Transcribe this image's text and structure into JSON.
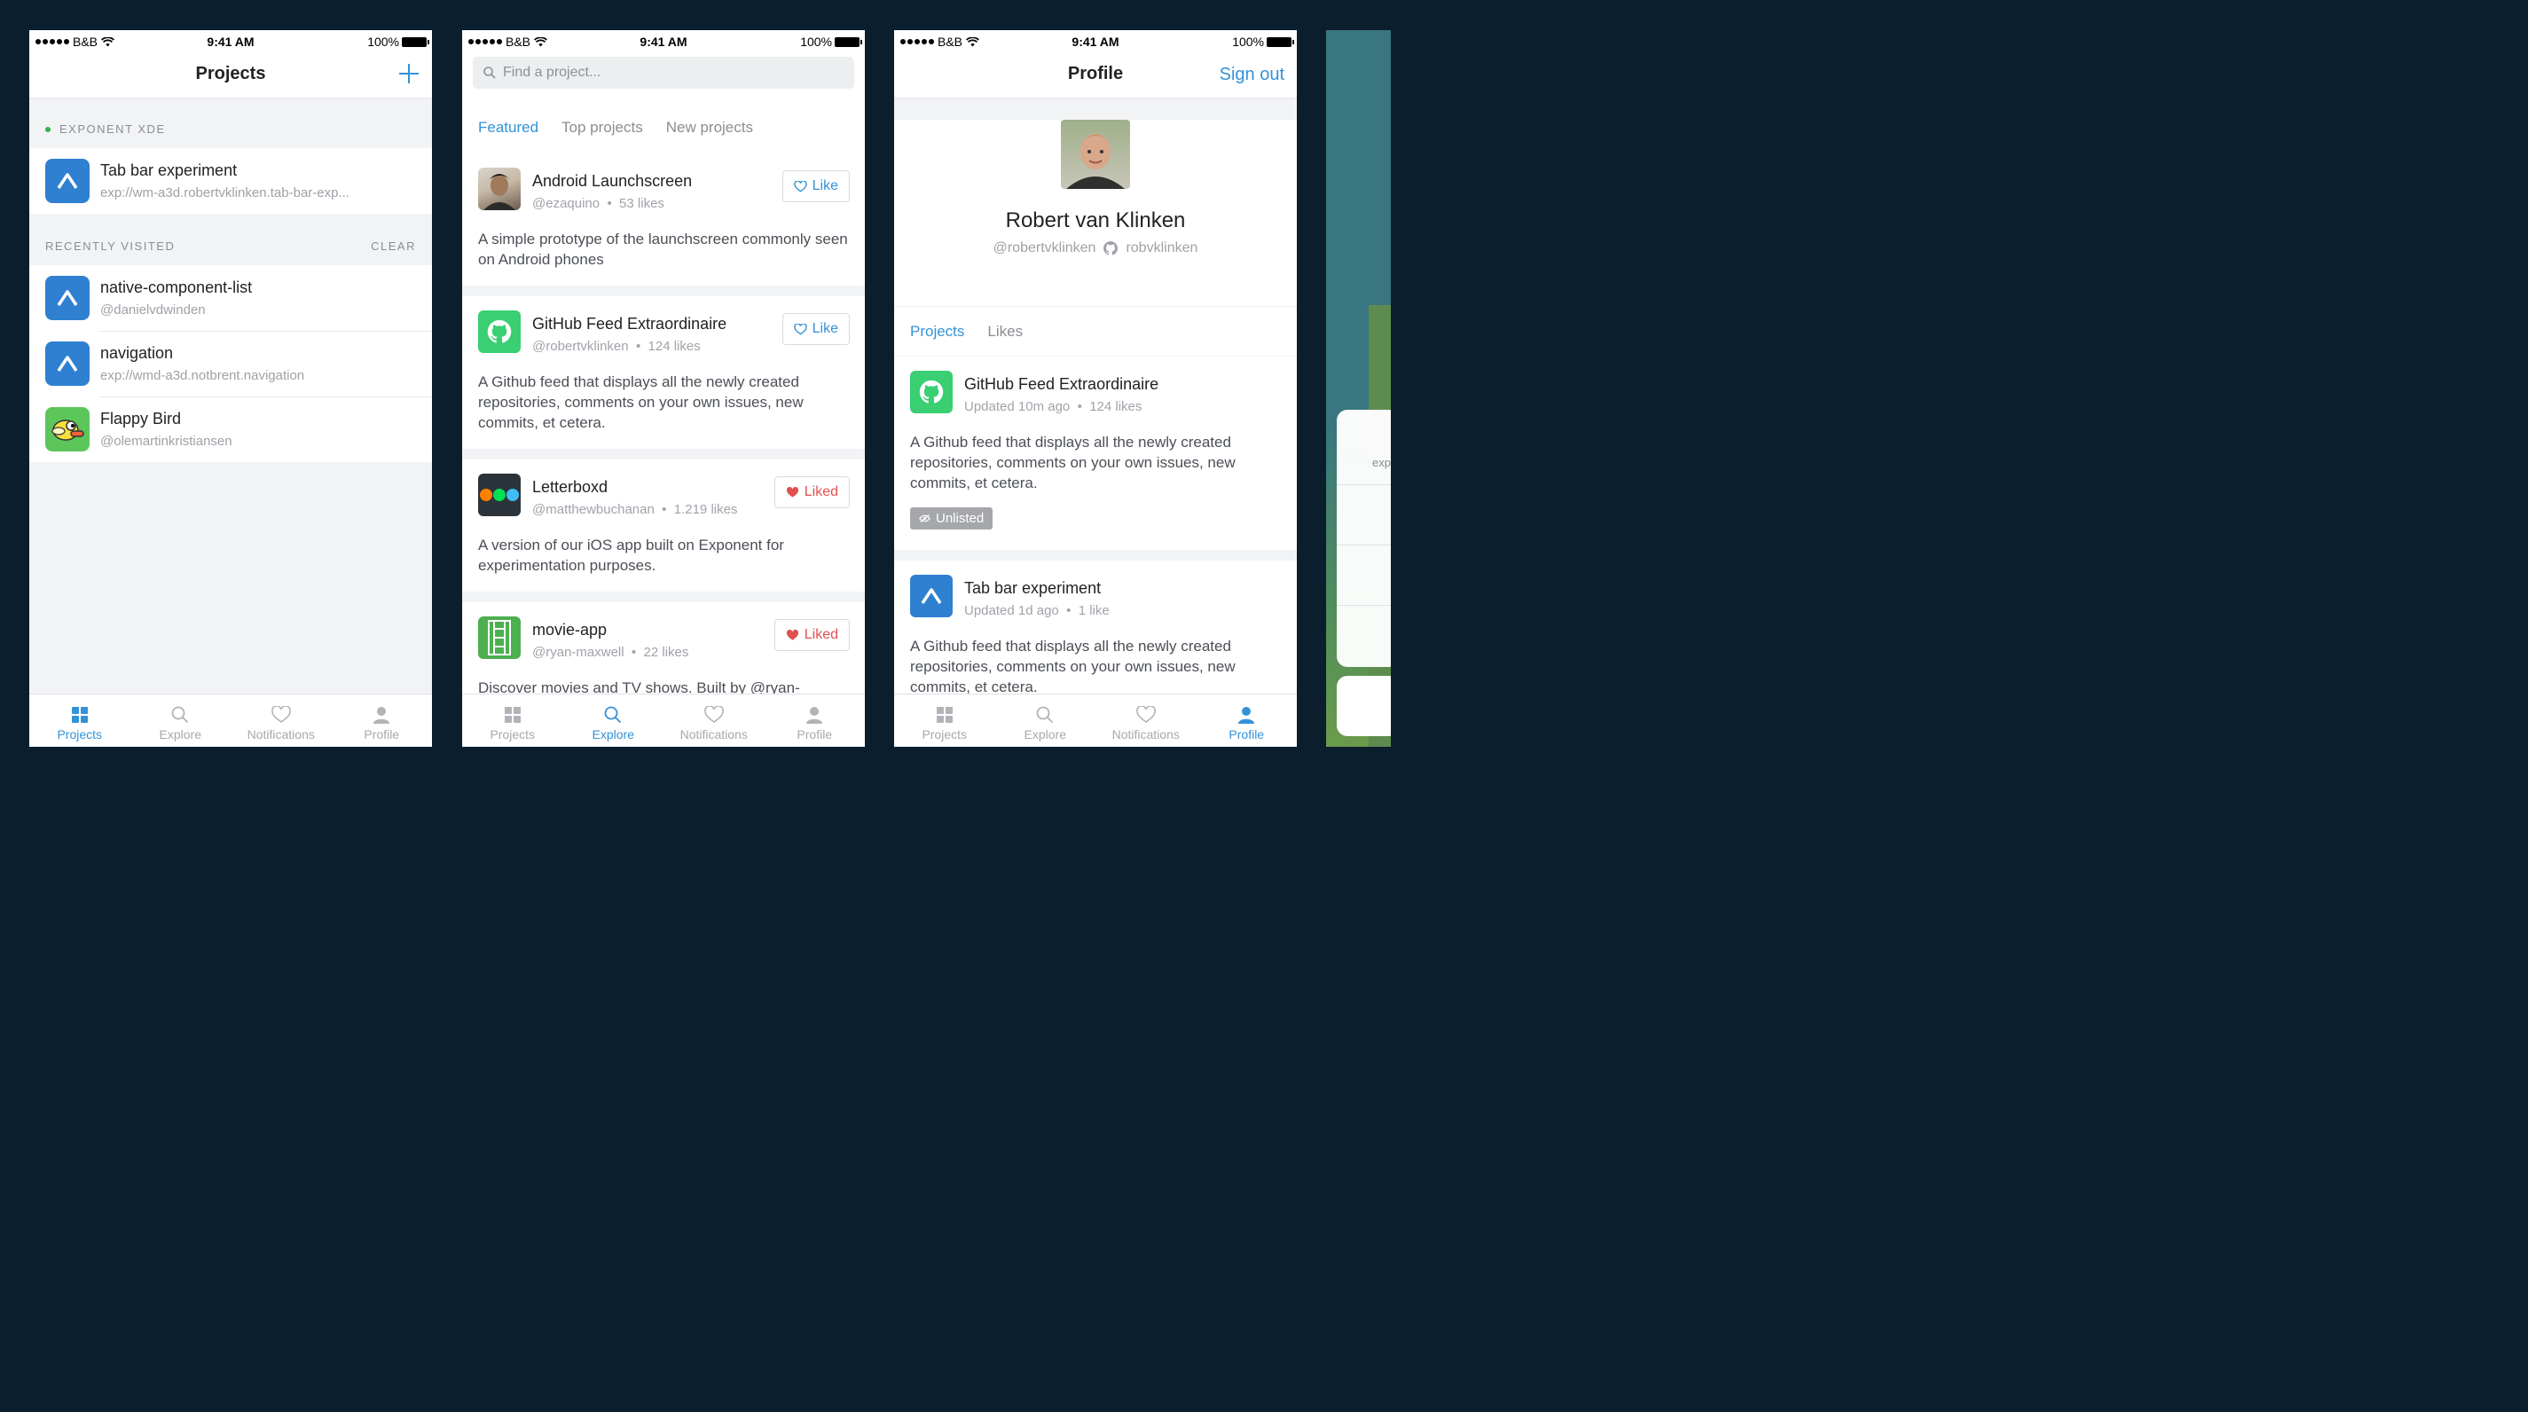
{
  "status": {
    "carrier": "B&B",
    "time": "9:41 AM",
    "battery": "100%"
  },
  "tabs": [
    "Projects",
    "Explore",
    "Notifications",
    "Profile"
  ],
  "projects": {
    "title": "Projects",
    "section1": "EXPONENT XDE",
    "current": {
      "name": "Tab bar experiment",
      "url": "exp://wm-a3d.robertvklinken.tab-bar-exp..."
    },
    "section2": "RECENTLY VISITED",
    "clear": "CLEAR",
    "recent": [
      {
        "name": "native-component-list",
        "sub": "@danielvdwinden"
      },
      {
        "name": "navigation",
        "sub": "exp://wmd-a3d.notbrent.navigation"
      },
      {
        "name": "Flappy Bird",
        "sub": "@olemartinkristiansen"
      }
    ]
  },
  "explore": {
    "search_placeholder": "Find a project...",
    "subtabs": [
      "Featured",
      "Top projects",
      "New projects"
    ],
    "cards": [
      {
        "name": "Android Launchscreen",
        "user": "@ezaquino",
        "likes": "53 likes",
        "button": "Like",
        "desc": "A simple prototype of the launchscreen commonly seen on Android phones"
      },
      {
        "name": "GitHub Feed Extraordinaire",
        "user": "@robertvklinken",
        "likes": "124 likes",
        "button": "Like",
        "desc": "A Github feed that displays all the newly created repositories, comments on your own issues, new commits, et cetera."
      },
      {
        "name": "Letterboxd",
        "user": "@matthewbuchanan",
        "likes": "1.219 likes",
        "button": "Liked",
        "desc": "A version of our iOS app built on Exponent for experimentation purposes."
      },
      {
        "name": "movie-app",
        "user": "@ryan-maxwell",
        "likes": "22 likes",
        "button": "Liked",
        "desc": "Discover movies and TV shows. Built by @ryan-"
      }
    ]
  },
  "profile": {
    "title": "Profile",
    "signout": "Sign out",
    "name": "Robert van Klinken",
    "handle": "@robertvklinken",
    "github": "robvklinken",
    "ptabs": [
      "Projects",
      "Likes"
    ],
    "cards": [
      {
        "name": "GitHub Feed Extraordinaire",
        "updated": "Updated 10m ago",
        "likes": "124 likes",
        "desc": "A Github feed that displays all the newly created repositories, comments on your own issues, new commits, et cetera.",
        "badge": "Unlisted"
      },
      {
        "name": "Tab bar experiment",
        "updated": "Updated 1d ago",
        "likes": "1 like",
        "desc": "A Github feed that displays all the newly created repositories, comments on your own issues, new commits, et cetera."
      }
    ]
  },
  "partial": {
    "text": "exp"
  },
  "colors": {
    "accent": "#3392d7",
    "liked": "#e25050",
    "online": "#2fb344",
    "background": "#0b1e2d"
  }
}
